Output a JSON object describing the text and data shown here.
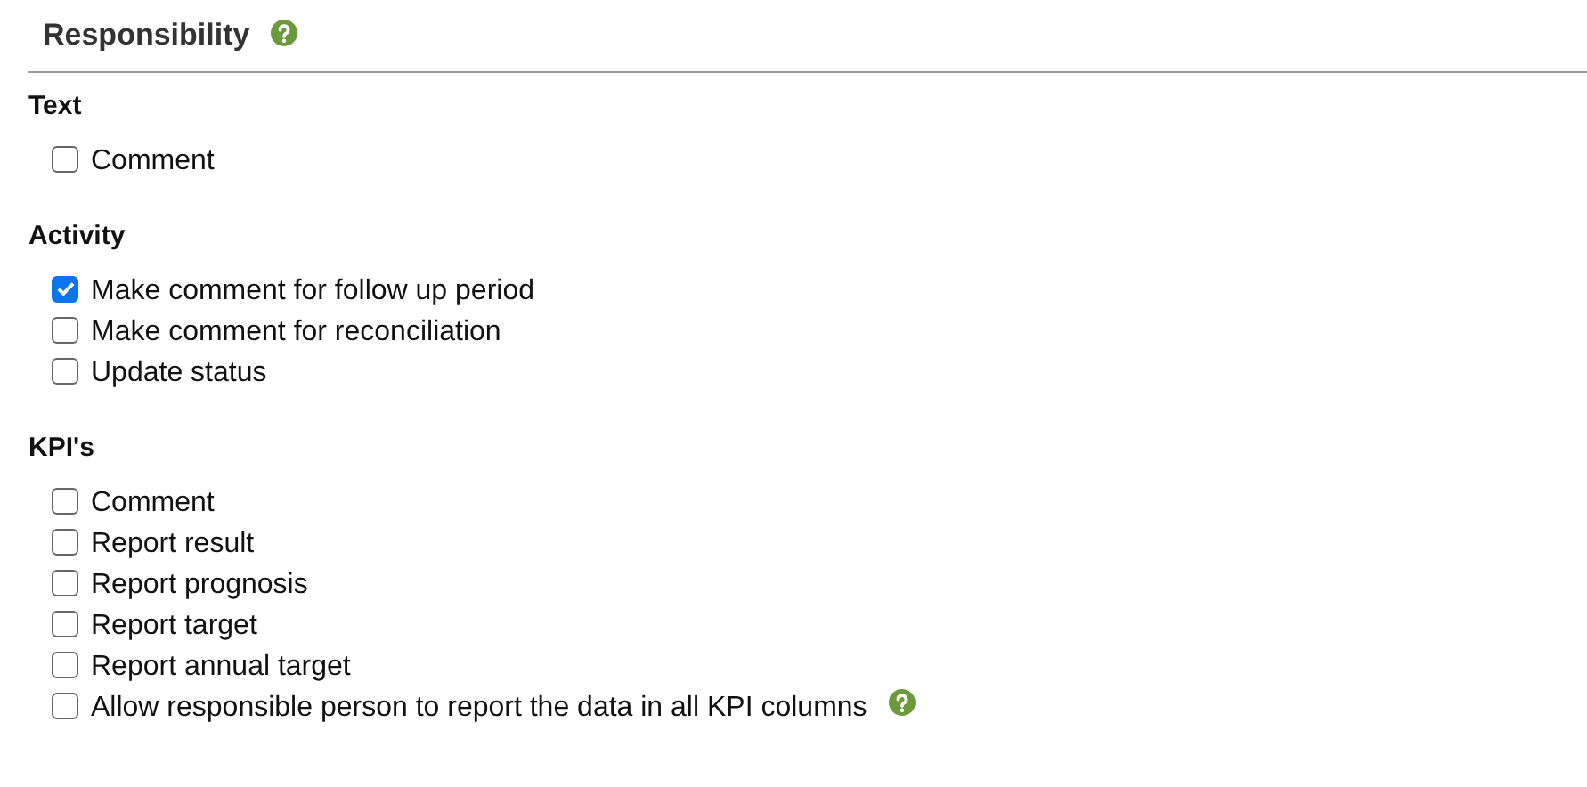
{
  "header": {
    "title": "Responsibility",
    "help": true
  },
  "sections": [
    {
      "title": "Text",
      "items": [
        {
          "label": "Comment",
          "checked": false,
          "help": false
        }
      ]
    },
    {
      "title": "Activity",
      "items": [
        {
          "label": "Make comment for follow up period",
          "checked": true,
          "help": false
        },
        {
          "label": "Make comment for reconciliation",
          "checked": false,
          "help": false
        },
        {
          "label": "Update status",
          "checked": false,
          "help": false
        }
      ]
    },
    {
      "title": "KPI's",
      "items": [
        {
          "label": "Comment",
          "checked": false,
          "help": false
        },
        {
          "label": "Report result",
          "checked": false,
          "help": false
        },
        {
          "label": "Report prognosis",
          "checked": false,
          "help": false
        },
        {
          "label": "Report target",
          "checked": false,
          "help": false
        },
        {
          "label": "Report annual target",
          "checked": false,
          "help": false
        },
        {
          "label": "Allow responsible person to report the data in all KPI columns",
          "checked": false,
          "help": true
        }
      ]
    }
  ]
}
